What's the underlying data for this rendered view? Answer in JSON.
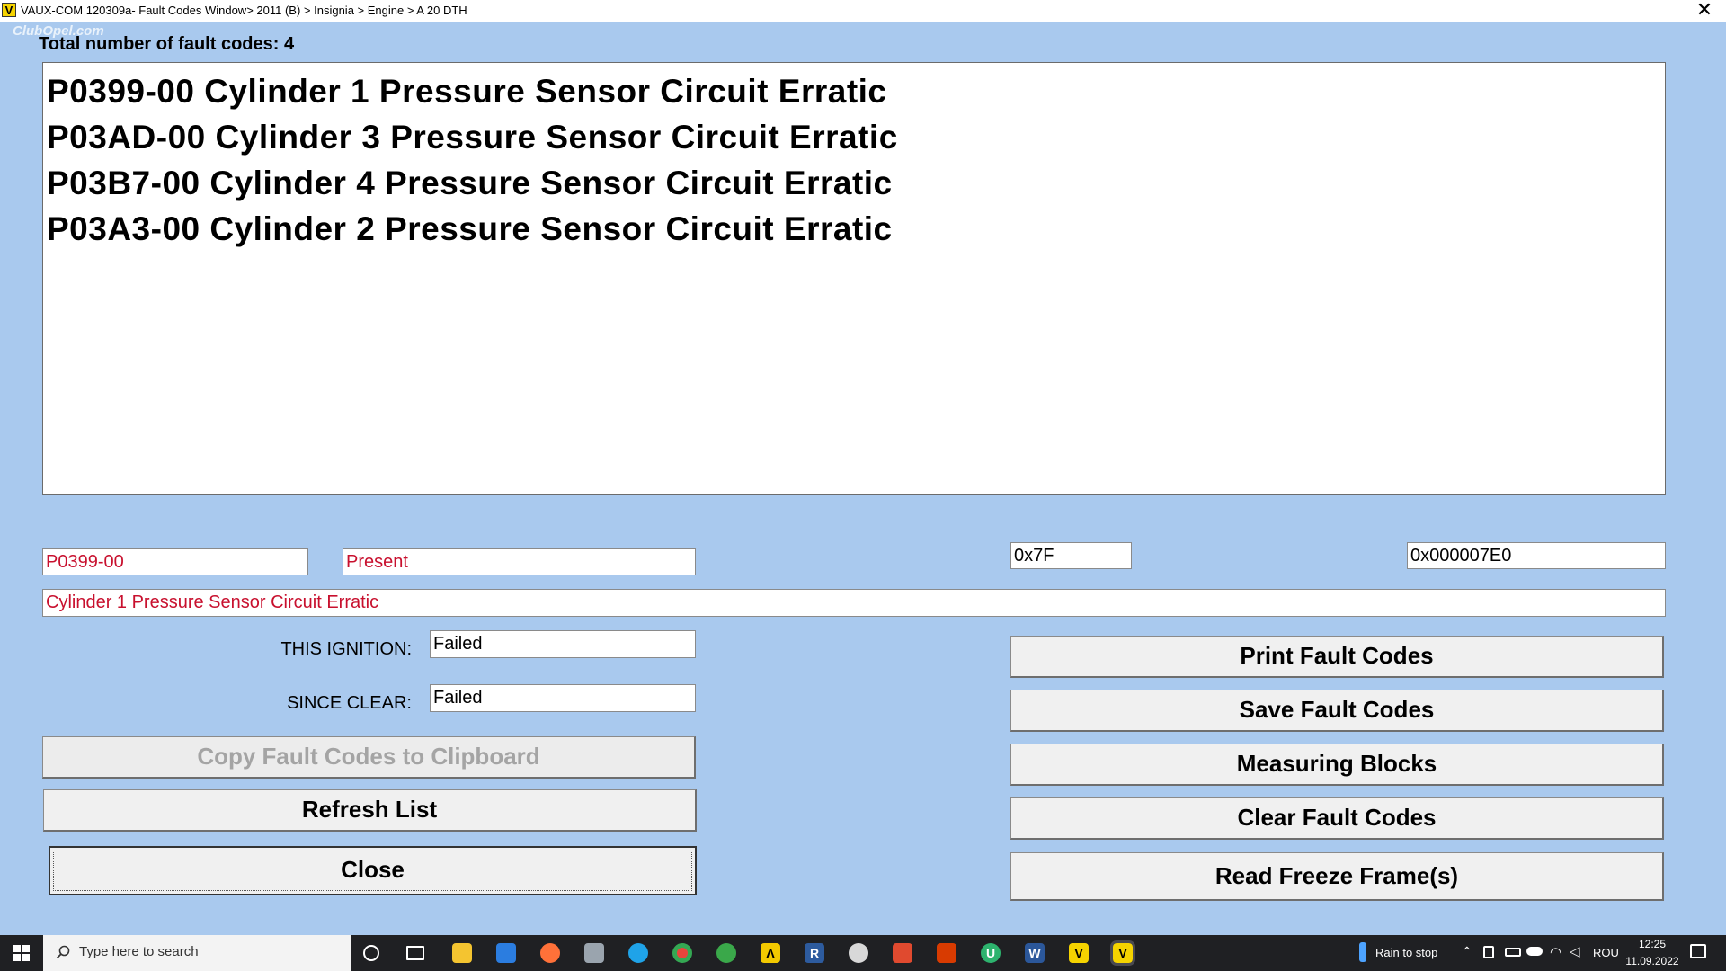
{
  "window": {
    "title": "VAUX-COM 120309a- Fault Codes Window> 2011 (B) > Insignia > Engine > A 20 DTH",
    "close_symbol": "✕",
    "watermark": "ClubOpel.com"
  },
  "fault_list": {
    "count_label": "Total number of fault codes:  4",
    "items": [
      "P0399-00 Cylinder 1 Pressure Sensor Circuit Erratic",
      "P03AD-00 Cylinder 3 Pressure Sensor Circuit Erratic",
      "P03B7-00 Cylinder 4 Pressure Sensor Circuit Erratic",
      "P03A3-00 Cylinder 2 Pressure Sensor Circuit Erratic"
    ]
  },
  "details": {
    "code": "P0399-00",
    "status": "Present",
    "hex1": "0x7F",
    "hex2": "0x000007E0",
    "description": "Cylinder 1 Pressure Sensor Circuit Erratic",
    "this_ignition_label": "THIS IGNITION:",
    "this_ignition_value": "Failed",
    "since_clear_label": "SINCE CLEAR:",
    "since_clear_value": "Failed"
  },
  "buttons": {
    "copy": "Copy Fault Codes to Clipboard",
    "refresh": "Refresh List",
    "close": "Close",
    "print": "Print Fault Codes",
    "save": "Save Fault Codes",
    "measuring": "Measuring Blocks",
    "clear": "Clear Fault Codes",
    "freeze": "Read Freeze Frame(s)"
  },
  "taskbar": {
    "search_placeholder": "Type here to search",
    "weather": "Rain to stop",
    "language": "ROU",
    "time": "12:25",
    "date": "11.09.2022"
  },
  "colors": {
    "window_bg": "#a9c9ee",
    "error_text": "#c8102e",
    "taskbar_bg": "#1f2023"
  }
}
